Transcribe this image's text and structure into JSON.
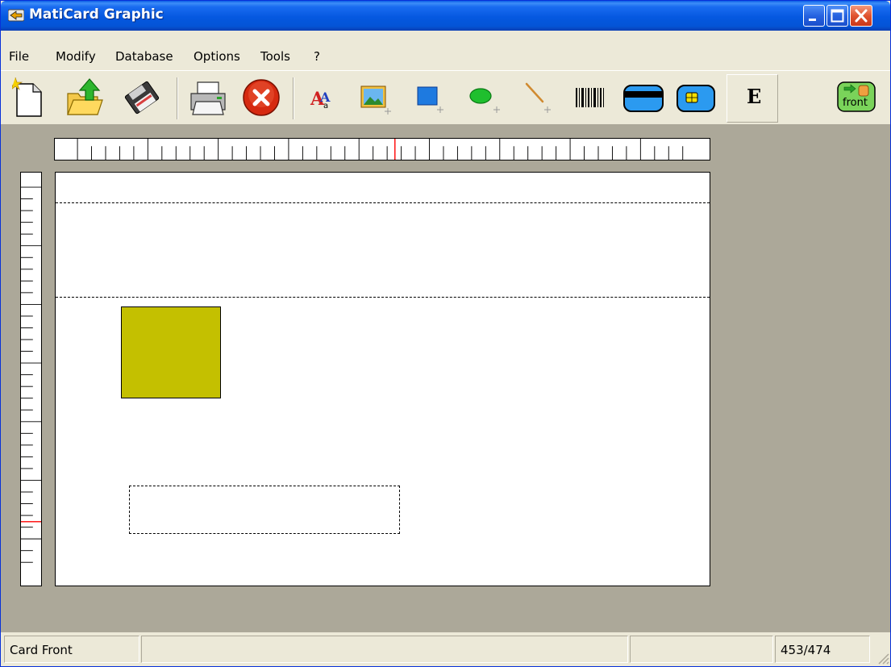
{
  "window": {
    "title": "MatiCard Graphic"
  },
  "menu": [
    "File",
    "Modify",
    "Database",
    "Options",
    "Tools",
    "?"
  ],
  "toolbar": {
    "text_tool_label": "A",
    "encode_label": "E",
    "side_label": "front"
  },
  "status": {
    "panel1": "Card Front",
    "panel2": "",
    "panel3": "",
    "panel4": "453/474"
  },
  "colors": {
    "titlebar": "#0558e0",
    "workspace": "#aca899",
    "shape_fill": "#c4c000",
    "ruler_marker": "#ff0000"
  }
}
